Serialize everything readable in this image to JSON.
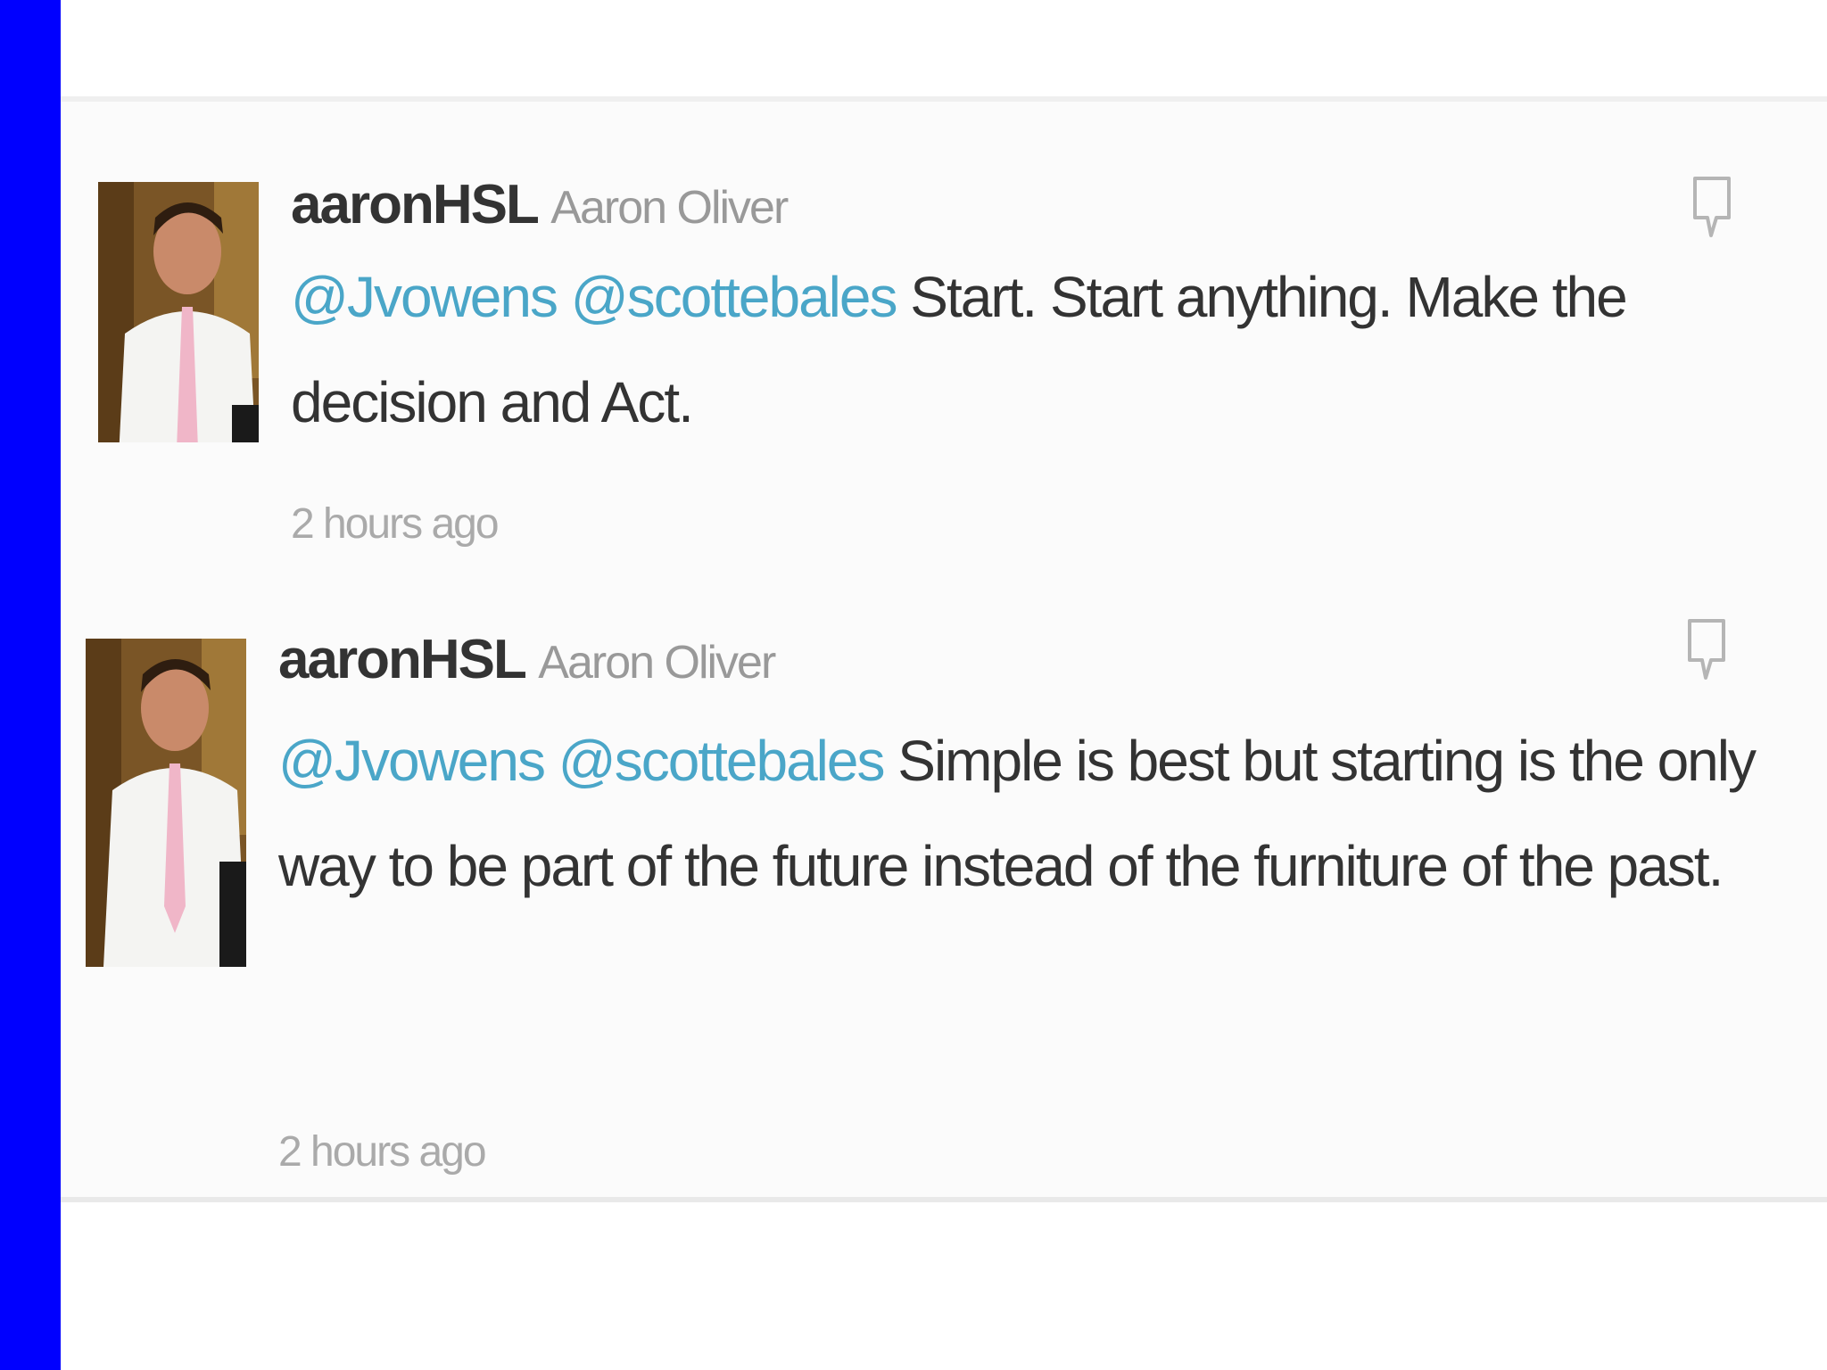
{
  "colors": {
    "side_bar": "#0000ff",
    "mention": "#4aa6c8",
    "handle": "#333333",
    "meta": "#999999"
  },
  "tweets": [
    {
      "handle": "aaronHSL",
      "name": "Aaron Oliver",
      "mention_1": "@Jvowens",
      "mention_2": "@scottebales",
      "text": "Start. Start anything. Make the decision and Act.",
      "time": "2 hours ago",
      "reply_icon": "reply-icon"
    },
    {
      "handle": "aaronHSL",
      "name": "Aaron Oliver",
      "mention_1": "@Jvowens",
      "mention_2": "@scottebales",
      "text": "Simple is best but starting is the only way to be part of the future instead of the furniture of the past.",
      "time": "2 hours ago",
      "reply_icon": "reply-icon"
    }
  ]
}
